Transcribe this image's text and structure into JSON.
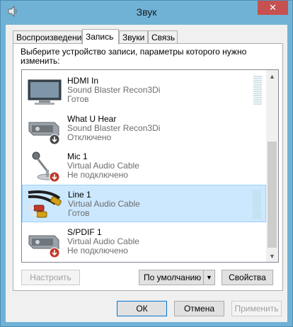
{
  "window": {
    "title": "Звук",
    "close_glyph": "✕"
  },
  "tabs": [
    {
      "label": "Воспроизведение",
      "active": false
    },
    {
      "label": "Запись",
      "active": true
    },
    {
      "label": "Звуки",
      "active": false
    },
    {
      "label": "Связь",
      "active": false
    }
  ],
  "instruction": "Выберите устройство записи, параметры которого нужно изменить:",
  "devices": [
    {
      "name": "HDMI In",
      "driver": "Sound Blaster Recon3Di",
      "status": "Готов",
      "icon": "monitor-icon",
      "has_meter": true,
      "selected": false
    },
    {
      "name": "What U Hear",
      "driver": "Sound Blaster Recon3Di",
      "status": "Отключено",
      "icon": "audio-device-disabled-icon",
      "has_meter": false,
      "selected": false
    },
    {
      "name": "Mic 1",
      "driver": "Virtual Audio Cable",
      "status": "Не подключено",
      "icon": "microphone-unplugged-icon",
      "has_meter": false,
      "selected": false
    },
    {
      "name": "Line 1",
      "driver": "Virtual Audio Cable",
      "status": "Готов",
      "icon": "rca-cable-icon",
      "has_meter": true,
      "selected": true
    },
    {
      "name": "S/PDIF 1",
      "driver": "Virtual Audio Cable",
      "status": "Не подключено",
      "icon": "audio-device-unplugged-icon",
      "has_meter": false,
      "selected": false
    }
  ],
  "buttons": {
    "configure": "Настроить",
    "set_default": "По умолчанию",
    "properties": "Свойства",
    "ok": "ОК",
    "cancel": "Отмена",
    "apply": "Применить"
  },
  "colors": {
    "selection": "#cce8ff",
    "close": "#c75050",
    "frame": "#6fb2d6"
  }
}
